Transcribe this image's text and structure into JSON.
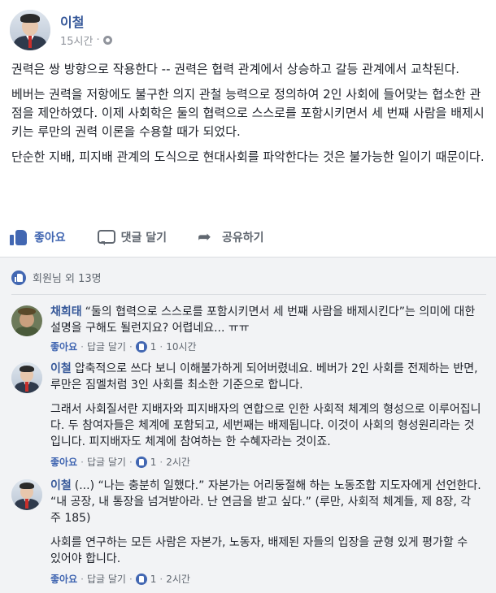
{
  "post": {
    "author": "이철",
    "time": "15시간",
    "dot": "·",
    "paragraphs": [
      "권력은 쌍 방향으로 작용한다 -- 권력은 협력 관계에서 상승하고 갈등 관계에서 교착된다.",
      "베버는 권력을 저항에도 불구한 의지 관철 능력으로 정의하여 2인 사회에 들어맞는 협소한 관점을 제안하였다. 이제 사회학은 둘의 협력으로 스스로를 포함시키면서 세 번째 사람을 배제시키는 루만의 권력 이론을 수용할 때가 되었다.",
      "단순한 지배, 피지배 관계의 도식으로 현대사회를 파악한다는 것은 불가능한 일이기 때문이다."
    ]
  },
  "actions": {
    "like": "좋아요",
    "comment": "댓글 달기",
    "share": "공유하기"
  },
  "likes_summary": "회원님 외 13명",
  "comments": [
    {
      "name": "채희태",
      "paragraphs": [
        "“둘의 협력으로 스스로를 포함시키면서 세 번째 사람을 배제시킨다”는 의미에 대한 설명을 구해도 될런지요? 어렵네요... ㅠㅠ"
      ],
      "like": "좋아요",
      "reply": "답글 달기",
      "count": "1",
      "time": "10시간"
    },
    {
      "name": "이철",
      "paragraphs": [
        "압축적으로 쓰다 보니 이해불가하게 되어버렸네요. 베버가 2인 사회를 전제하는 반면, 루만은 짐멜처럼 3인 사회를 최소한 기준으로 합니다.",
        "그래서 사회질서란 지배자와 피지배자의 연합으로 인한 사회적 체계의 형성으로 이루어집니다. 두 참여자들은 체계에 포함되고, 세번째는 배제됩니다. 이것이 사회의 형성원리라는 것입니다. 피지배자도 체계에 참여하는 한 수혜자라는 것이죠."
      ],
      "like": "좋아요",
      "reply": "답글 달기",
      "count": "1",
      "time": "2시간"
    },
    {
      "name": "이철",
      "paragraphs": [
        "(...) “나는 충분히 일했다.” 자본가는 어리둥절해 하는 노동조합 지도자에게 선언한다. “내 공장, 내 통장을 넘겨받아라. 난 연금을 받고 싶다.” (루만, 사회적 체계들, 제 8장, 각주 185)",
        "사회를 연구하는 모든 사람은 자본가, 노동자, 배제된 자들의 입장을 균형 있게 평가할 수 있어야 합니다."
      ],
      "like": "좋아요",
      "reply": "답글 달기",
      "count": "1",
      "time": "2시간"
    }
  ],
  "colors": {
    "link": "#365899",
    "accent": "#4267b2",
    "muted": "#90949c"
  }
}
